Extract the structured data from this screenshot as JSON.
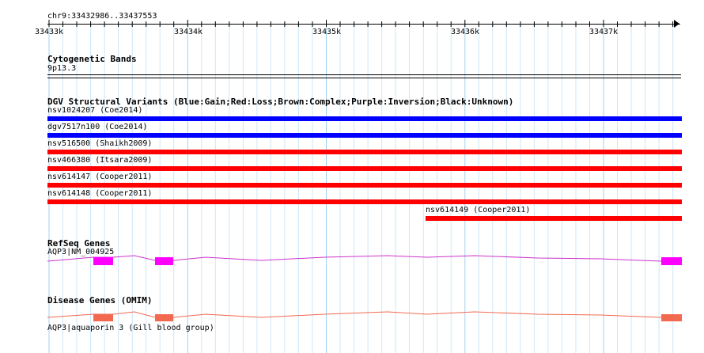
{
  "ruler": {
    "range_label": "chr9:33432986..33437553",
    "ticks": [
      "33433k",
      "33434k",
      "33435k",
      "33436k",
      "33437k"
    ]
  },
  "cytoband": {
    "title": "Cytogenetic Bands",
    "band": "9p13.3"
  },
  "dgv": {
    "title": "DGV Structural Variants (Blue:Gain;Red:Loss;Brown:Complex;Purple:Inversion;Black:Unknown)",
    "variants": [
      {
        "label": "nsv1024207 (Coe2014)",
        "type": "gain",
        "color": "#0000ff"
      },
      {
        "label": "dgv7517n100 (Coe2014)",
        "type": "gain",
        "color": "#0000ff"
      },
      {
        "label": "nsv516500 (Shaikh2009)",
        "type": "loss",
        "color": "#ff0000"
      },
      {
        "label": "nsv466380 (Itsara2009)",
        "type": "loss",
        "color": "#ff0000"
      },
      {
        "label": "nsv614147 (Cooper2011)",
        "type": "loss",
        "color": "#ff0000"
      },
      {
        "label": "nsv614148 (Cooper2011)",
        "type": "loss",
        "color": "#ff0000"
      },
      {
        "label": "nsv614149 (Cooper2011)",
        "type": "loss",
        "color": "#ff0000"
      }
    ]
  },
  "refseq": {
    "title": "RefSeq Genes",
    "gene_label": "AQP3|NM_004925",
    "color": "#ff00ff",
    "intron_color": "#cc33cc"
  },
  "disease": {
    "title": "Disease Genes (OMIM)",
    "gene_label": "AQP3|aquaporin 3 (Gill blood group)",
    "color": "#f26950"
  }
}
